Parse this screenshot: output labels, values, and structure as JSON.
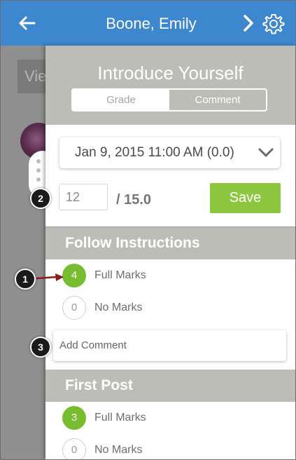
{
  "header": {
    "title": "Boone, Emily",
    "back_icon": "back-arrow-icon",
    "next_icon": "chevron-right-icon",
    "settings_icon": "gear-icon",
    "color": "#3d87cf"
  },
  "background": {
    "view_button_label": "Vie"
  },
  "assignment": {
    "title": "Introduce Yourself",
    "tabs": [
      {
        "label": "Grade",
        "selected": false
      },
      {
        "label": "Comment",
        "selected": true
      }
    ]
  },
  "submission": {
    "selected": "Jan 9, 2015 11:00 AM (0.0)"
  },
  "grading": {
    "score": "12",
    "points_possible": "/ 15.0",
    "save_label": "Save",
    "save_color": "#8dc63f"
  },
  "rubric": [
    {
      "name": "Follow Instructions",
      "ratings": [
        {
          "points": "4",
          "label": "Full Marks",
          "selected": true
        },
        {
          "points": "0",
          "label": "No Marks",
          "selected": false
        }
      ],
      "comment_placeholder": "Add Comment"
    },
    {
      "name": "First Post",
      "ratings": [
        {
          "points": "3",
          "label": "Full Marks",
          "selected": true
        },
        {
          "points": "0",
          "label": "No Marks",
          "selected": false
        }
      ]
    }
  ],
  "callouts": [
    "1",
    "2",
    "3"
  ],
  "colors": {
    "accent_green": "#77bd2f",
    "panel_header": "#bdbdb7"
  }
}
